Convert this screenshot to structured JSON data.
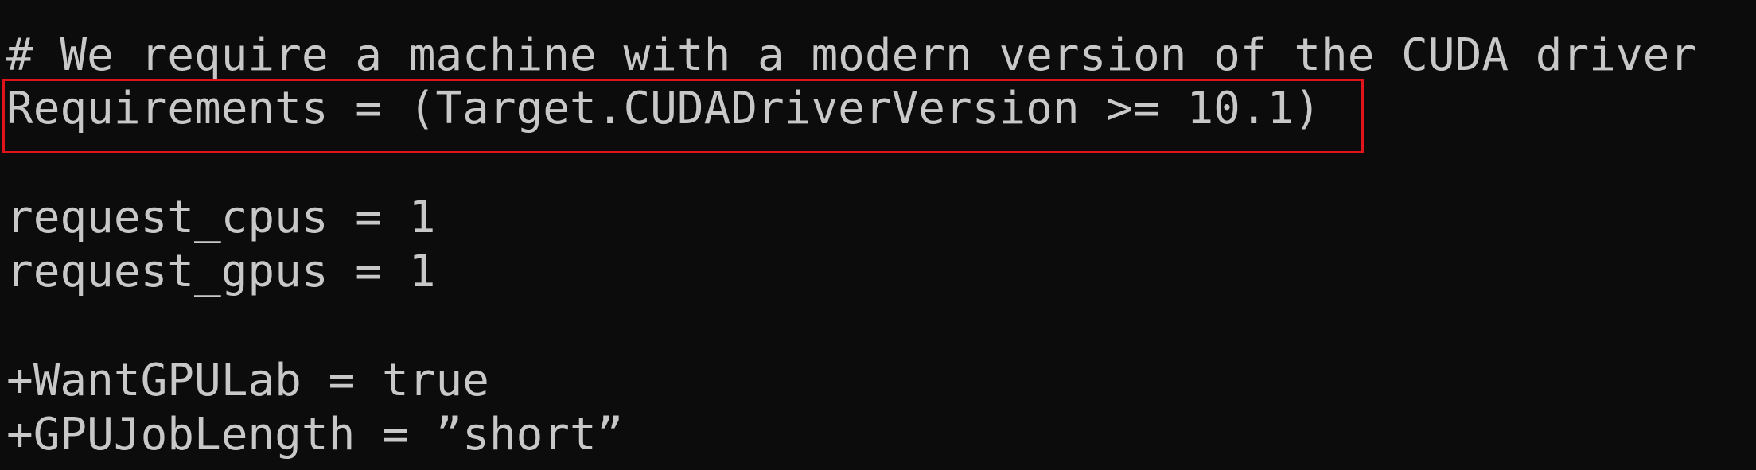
{
  "terminal": {
    "lines": [
      "# We require a machine with a modern version of the CUDA driver",
      "Requirements = (Target.CUDADriverVersion >= 10.1)",
      "request_cpus = 1",
      "request_gpus = 1",
      "+WantGPULab = true",
      "+GPUJobLength = ”short”"
    ]
  },
  "colors": {
    "background": "#0c0c0c",
    "text": "#c8c8c8",
    "highlight": "#e1141c"
  }
}
